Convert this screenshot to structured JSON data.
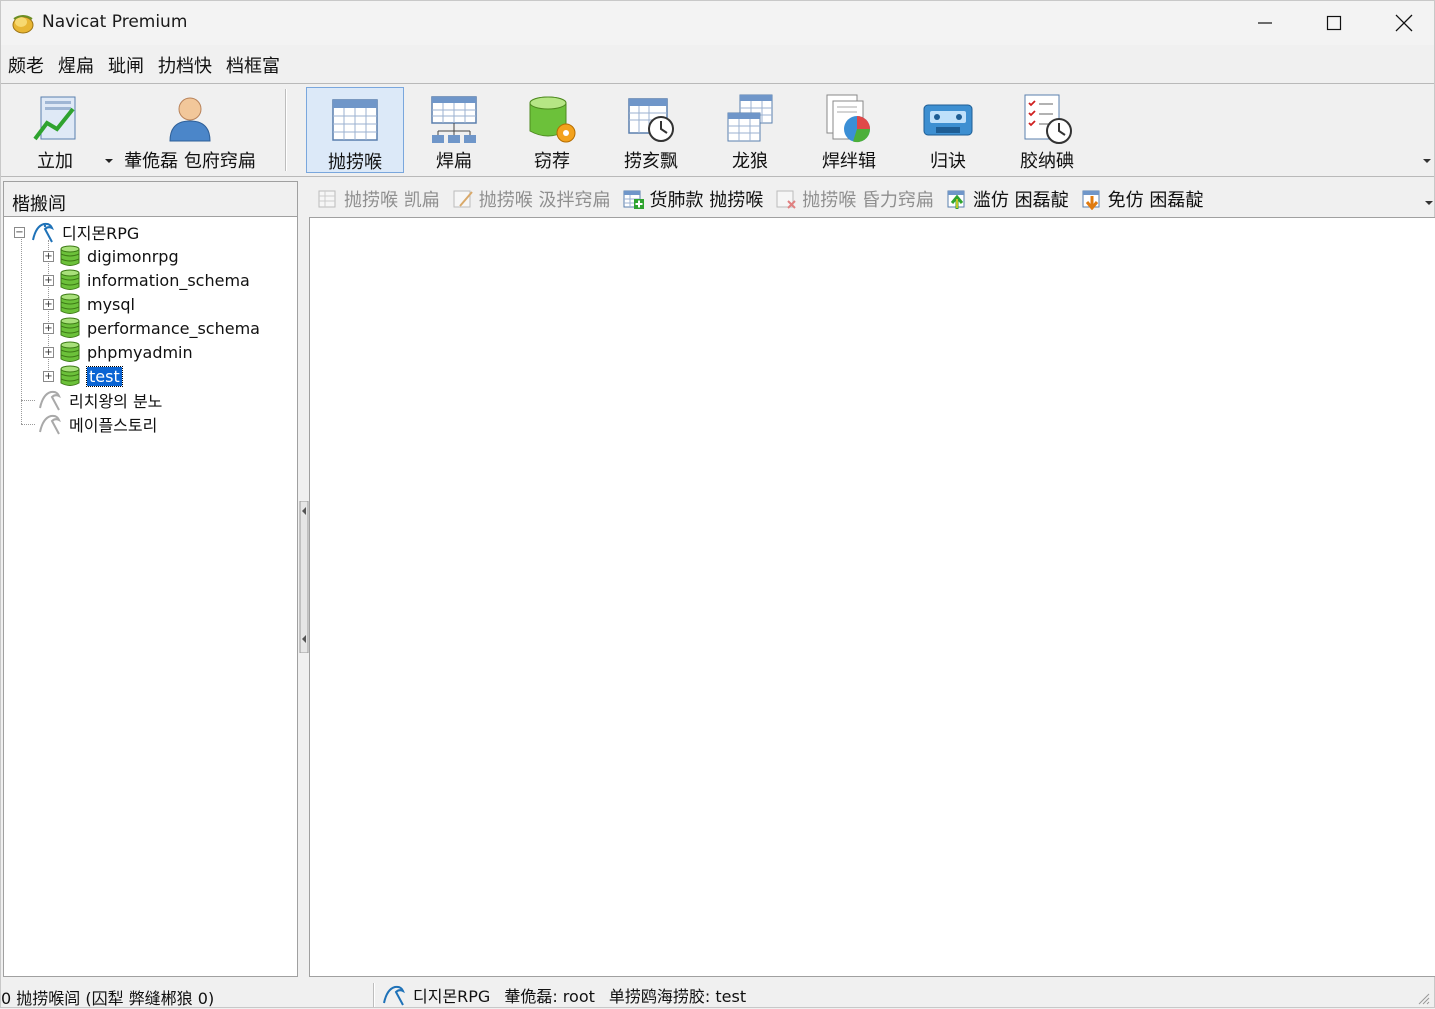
{
  "window": {
    "title": "Navicat Premium",
    "icons": {
      "app": "navicat-app-icon",
      "minimize": "minimize-icon",
      "maximize": "maximize-icon",
      "close": "close-icon"
    }
  },
  "menu": {
    "items": [
      "颇老",
      "煋扁",
      "玼闸",
      "扐档快",
      "档框富"
    ]
  },
  "toolbar": {
    "connection": {
      "label": "立加",
      "icon": "connection-chart-icon"
    },
    "user": {
      "label": "輂佹磊 包府窍扁",
      "icon": "user-icon"
    },
    "buttons": [
      {
        "label": "抛捞喉",
        "icon": "table-icon",
        "active": true
      },
      {
        "label": "焊扁",
        "icon": "view-icon",
        "active": false
      },
      {
        "label": "窃荐",
        "icon": "function-icon",
        "active": false
      },
      {
        "label": "捞亥飘",
        "icon": "event-icon",
        "active": false
      },
      {
        "label": "龙狼",
        "icon": "query-icon",
        "active": false
      },
      {
        "label": "焊绊辑",
        "icon": "report-icon",
        "active": false
      },
      {
        "label": "归诀",
        "icon": "backup-icon",
        "active": false
      },
      {
        "label": "胶纳碘",
        "icon": "schedule-icon",
        "active": false
      }
    ]
  },
  "left_pane": {
    "header": "楷搬闾",
    "connections": [
      {
        "name": "디지몬RPG",
        "open": true,
        "databases": [
          "digimonrpg",
          "information_schema",
          "mysql",
          "performance_schema",
          "phpmyadmin",
          "test"
        ],
        "selected": "test"
      },
      {
        "name": "리치왕의 분노",
        "open": false
      },
      {
        "name": "메이플스토리",
        "open": false
      }
    ]
  },
  "object_toolbar": {
    "buttons": [
      {
        "label": "抛捞喉 凯扁",
        "icon": "open-table-icon",
        "enabled": false
      },
      {
        "label": "抛捞喉 汲拌窍扁",
        "icon": "design-table-icon",
        "enabled": false
      },
      {
        "label": "货肺款 抛捞喉",
        "icon": "new-table-icon",
        "enabled": true
      },
      {
        "label": "抛捞喉 昏力窍扁",
        "icon": "delete-table-icon",
        "enabled": false
      },
      {
        "label": "滥仿 困磊靛",
        "icon": "import-wizard-icon",
        "enabled": true
      },
      {
        "label": "免仿 困磊靛",
        "icon": "export-wizard-icon",
        "enabled": true
      }
    ]
  },
  "status": {
    "count": "0 抛捞喉闾 (囚犁 弊缝郴狼 0)",
    "connection": "디지몬RPG",
    "user": "輂佹磊: root",
    "database": "单捞鸥海捞胶: test"
  }
}
